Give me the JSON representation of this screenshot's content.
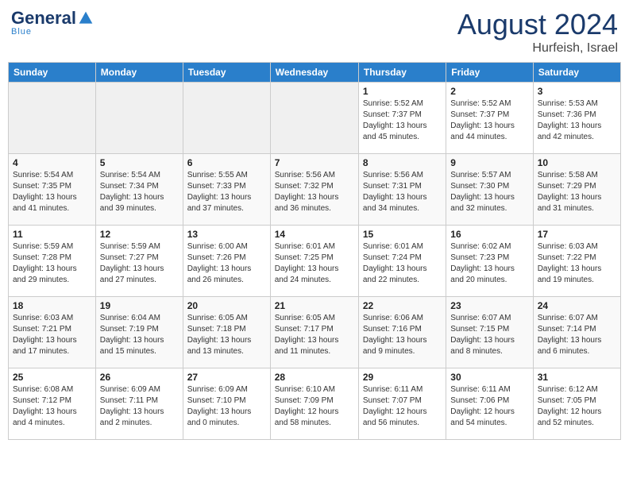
{
  "header": {
    "logo": {
      "general": "General",
      "blue": "Blue",
      "tagline": "Blue"
    },
    "month_year": "August 2024",
    "location": "Hurfeish, Israel"
  },
  "calendar": {
    "days_of_week": [
      "Sunday",
      "Monday",
      "Tuesday",
      "Wednesday",
      "Thursday",
      "Friday",
      "Saturday"
    ],
    "weeks": [
      [
        {
          "day": "",
          "info": ""
        },
        {
          "day": "",
          "info": ""
        },
        {
          "day": "",
          "info": ""
        },
        {
          "day": "",
          "info": ""
        },
        {
          "day": "1",
          "info": "Sunrise: 5:52 AM\nSunset: 7:37 PM\nDaylight: 13 hours\nand 45 minutes."
        },
        {
          "day": "2",
          "info": "Sunrise: 5:52 AM\nSunset: 7:37 PM\nDaylight: 13 hours\nand 44 minutes."
        },
        {
          "day": "3",
          "info": "Sunrise: 5:53 AM\nSunset: 7:36 PM\nDaylight: 13 hours\nand 42 minutes."
        }
      ],
      [
        {
          "day": "4",
          "info": "Sunrise: 5:54 AM\nSunset: 7:35 PM\nDaylight: 13 hours\nand 41 minutes."
        },
        {
          "day": "5",
          "info": "Sunrise: 5:54 AM\nSunset: 7:34 PM\nDaylight: 13 hours\nand 39 minutes."
        },
        {
          "day": "6",
          "info": "Sunrise: 5:55 AM\nSunset: 7:33 PM\nDaylight: 13 hours\nand 37 minutes."
        },
        {
          "day": "7",
          "info": "Sunrise: 5:56 AM\nSunset: 7:32 PM\nDaylight: 13 hours\nand 36 minutes."
        },
        {
          "day": "8",
          "info": "Sunrise: 5:56 AM\nSunset: 7:31 PM\nDaylight: 13 hours\nand 34 minutes."
        },
        {
          "day": "9",
          "info": "Sunrise: 5:57 AM\nSunset: 7:30 PM\nDaylight: 13 hours\nand 32 minutes."
        },
        {
          "day": "10",
          "info": "Sunrise: 5:58 AM\nSunset: 7:29 PM\nDaylight: 13 hours\nand 31 minutes."
        }
      ],
      [
        {
          "day": "11",
          "info": "Sunrise: 5:59 AM\nSunset: 7:28 PM\nDaylight: 13 hours\nand 29 minutes."
        },
        {
          "day": "12",
          "info": "Sunrise: 5:59 AM\nSunset: 7:27 PM\nDaylight: 13 hours\nand 27 minutes."
        },
        {
          "day": "13",
          "info": "Sunrise: 6:00 AM\nSunset: 7:26 PM\nDaylight: 13 hours\nand 26 minutes."
        },
        {
          "day": "14",
          "info": "Sunrise: 6:01 AM\nSunset: 7:25 PM\nDaylight: 13 hours\nand 24 minutes."
        },
        {
          "day": "15",
          "info": "Sunrise: 6:01 AM\nSunset: 7:24 PM\nDaylight: 13 hours\nand 22 minutes."
        },
        {
          "day": "16",
          "info": "Sunrise: 6:02 AM\nSunset: 7:23 PM\nDaylight: 13 hours\nand 20 minutes."
        },
        {
          "day": "17",
          "info": "Sunrise: 6:03 AM\nSunset: 7:22 PM\nDaylight: 13 hours\nand 19 minutes."
        }
      ],
      [
        {
          "day": "18",
          "info": "Sunrise: 6:03 AM\nSunset: 7:21 PM\nDaylight: 13 hours\nand 17 minutes."
        },
        {
          "day": "19",
          "info": "Sunrise: 6:04 AM\nSunset: 7:19 PM\nDaylight: 13 hours\nand 15 minutes."
        },
        {
          "day": "20",
          "info": "Sunrise: 6:05 AM\nSunset: 7:18 PM\nDaylight: 13 hours\nand 13 minutes."
        },
        {
          "day": "21",
          "info": "Sunrise: 6:05 AM\nSunset: 7:17 PM\nDaylight: 13 hours\nand 11 minutes."
        },
        {
          "day": "22",
          "info": "Sunrise: 6:06 AM\nSunset: 7:16 PM\nDaylight: 13 hours\nand 9 minutes."
        },
        {
          "day": "23",
          "info": "Sunrise: 6:07 AM\nSunset: 7:15 PM\nDaylight: 13 hours\nand 8 minutes."
        },
        {
          "day": "24",
          "info": "Sunrise: 6:07 AM\nSunset: 7:14 PM\nDaylight: 13 hours\nand 6 minutes."
        }
      ],
      [
        {
          "day": "25",
          "info": "Sunrise: 6:08 AM\nSunset: 7:12 PM\nDaylight: 13 hours\nand 4 minutes."
        },
        {
          "day": "26",
          "info": "Sunrise: 6:09 AM\nSunset: 7:11 PM\nDaylight: 13 hours\nand 2 minutes."
        },
        {
          "day": "27",
          "info": "Sunrise: 6:09 AM\nSunset: 7:10 PM\nDaylight: 13 hours\nand 0 minutes."
        },
        {
          "day": "28",
          "info": "Sunrise: 6:10 AM\nSunset: 7:09 PM\nDaylight: 12 hours\nand 58 minutes."
        },
        {
          "day": "29",
          "info": "Sunrise: 6:11 AM\nSunset: 7:07 PM\nDaylight: 12 hours\nand 56 minutes."
        },
        {
          "day": "30",
          "info": "Sunrise: 6:11 AM\nSunset: 7:06 PM\nDaylight: 12 hours\nand 54 minutes."
        },
        {
          "day": "31",
          "info": "Sunrise: 6:12 AM\nSunset: 7:05 PM\nDaylight: 12 hours\nand 52 minutes."
        }
      ]
    ]
  }
}
